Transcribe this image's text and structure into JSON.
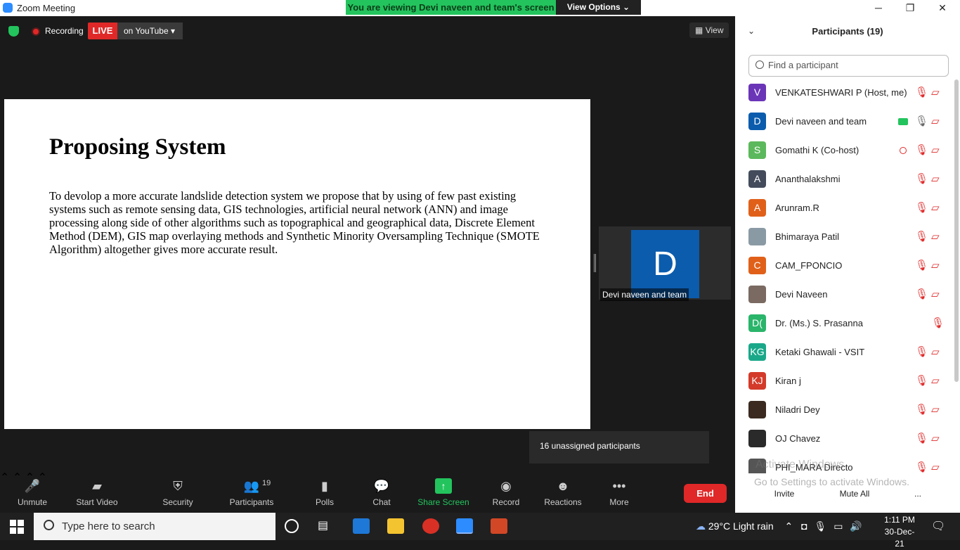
{
  "window": {
    "title": "Zoom Meeting",
    "viewing_banner": "You are viewing Devi naveen and team's screen",
    "view_options": "View Options ⌄",
    "min": "─",
    "max": "❐",
    "close": "✕"
  },
  "topbar": {
    "recording": "Recording",
    "live": "LIVE",
    "live_platform": "on YouTube",
    "view": "View"
  },
  "slide": {
    "title": "Proposing System",
    "body": "To devolop a more accurate landslide detection system we propose that by using of few past existing systems such as remote sensing data, GIS technologies, artificial neural network (ANN) and image processing along side of other algorithms such as topographical and geographical data, Discrete Element Method (DEM), GIS map overlaying methods and Synthetic Minority Oversampling Technique (SMOTE Algorithm) altogether gives more accurate result."
  },
  "video_tile": {
    "initial": "D",
    "name": "Devi naveen and team",
    "color": "#0b5cad"
  },
  "tooltip": "16 unassigned participants",
  "toolbar": {
    "unmute": "Unmute",
    "start_video": "Start Video",
    "security": "Security",
    "participants": "Participants",
    "participants_count": "19",
    "polls": "Polls",
    "chat": "Chat",
    "share_screen": "Share Screen",
    "record": "Record",
    "reactions": "Reactions",
    "more": "More",
    "end": "End"
  },
  "panel": {
    "title": "Participants (19)",
    "search_placeholder": "Find a participant",
    "participants": [
      {
        "initial": "V",
        "name": "VENKATESHWARI P (Host, me)",
        "color": "#6b35b8"
      },
      {
        "initial": "D",
        "name": "Devi naveen and team",
        "color": "#0b5cad"
      },
      {
        "initial": "S",
        "name": "Gomathi K (Co-host)",
        "color": "#5cb85c"
      },
      {
        "initial": "A",
        "name": "Ananthalakshmi",
        "color": "#444c5c"
      },
      {
        "initial": "A",
        "name": "Arunram.R",
        "color": "#e0601a"
      },
      {
        "initial": "",
        "name": "Bhimaraya Patil",
        "color": "#8a9aa5"
      },
      {
        "initial": "C",
        "name": "CAM_FPONCIO",
        "color": "#e0601a"
      },
      {
        "initial": "",
        "name": "Devi Naveen",
        "color": "#7a6a62"
      },
      {
        "initial": "D(",
        "name": "Dr. (Ms.) S. Prasanna",
        "color": "#2ab56a"
      },
      {
        "initial": "KG",
        "name": "Ketaki Ghawali - VSIT",
        "color": "#1aa889"
      },
      {
        "initial": "KJ",
        "name": "Kiran j",
        "color": "#d43a2a"
      },
      {
        "initial": "",
        "name": "Niladri Dey",
        "color": "#3a2a20"
      },
      {
        "initial": "",
        "name": "OJ Chavez",
        "color": "#2a2a2a"
      },
      {
        "initial": "",
        "name": "PHI_MARA Directo",
        "color": "#555555"
      }
    ],
    "watermark_1": "Activate Windows",
    "watermark_2": "Go to Settings to activate Windows.",
    "invite": "Invite",
    "mute_all": "Mute All",
    "more": "..."
  },
  "taskbar": {
    "search_placeholder": "Type here to search",
    "weather": "29°C  Light rain",
    "time": "1:11 PM",
    "date": "30-Dec-21"
  }
}
